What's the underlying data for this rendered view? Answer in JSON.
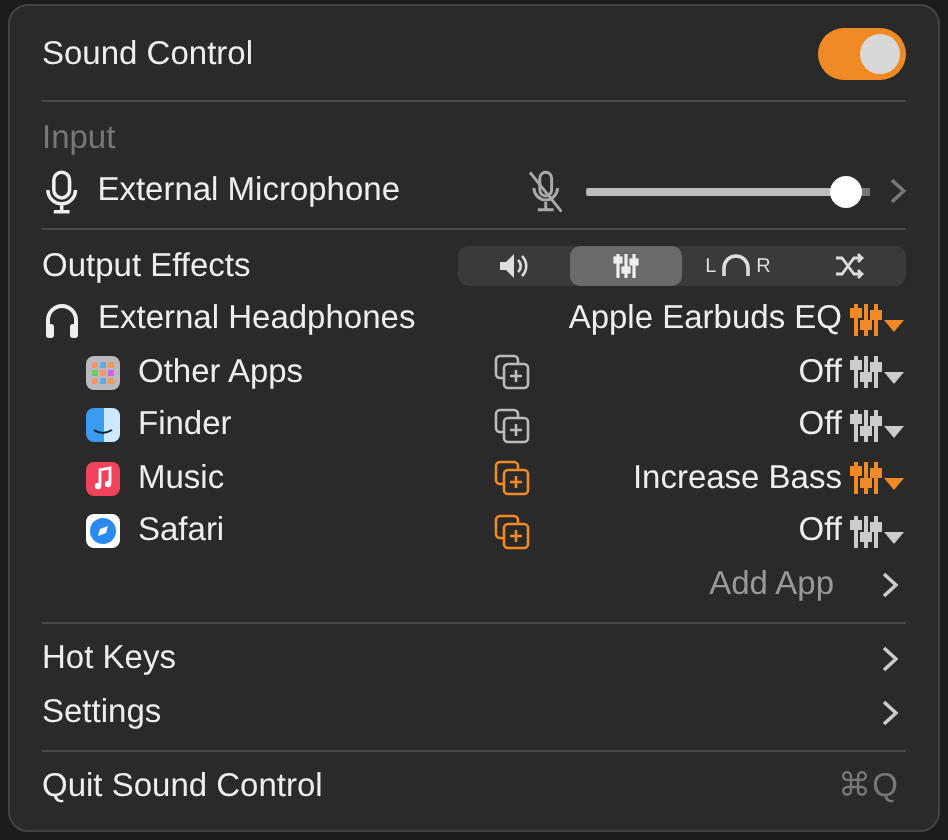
{
  "header": {
    "title": "Sound Control",
    "enabled": true
  },
  "input": {
    "heading": "Input",
    "device": "External Microphone",
    "muted": false,
    "level": 0.97
  },
  "output": {
    "heading": "Output Effects",
    "tabs": [
      {
        "kind": "volume",
        "selected": false
      },
      {
        "kind": "equalizer",
        "selected": true
      },
      {
        "kind": "balance",
        "left": "L",
        "right": "R",
        "selected": false
      },
      {
        "kind": "shuffle",
        "selected": false
      }
    ],
    "device": "External Headphones",
    "device_effect": "Apple Earbuds EQ",
    "device_eq_active": true,
    "apps": [
      {
        "kind": "grid",
        "name": "Other Apps",
        "copy_active": false,
        "effect": "Off",
        "eq_active": false
      },
      {
        "kind": "finder",
        "name": "Finder",
        "copy_active": false,
        "effect": "Off",
        "eq_active": false
      },
      {
        "kind": "music",
        "name": "Music",
        "copy_active": true,
        "effect": "Increase Bass",
        "eq_active": true
      },
      {
        "kind": "safari",
        "name": "Safari",
        "copy_active": true,
        "effect": "Off",
        "eq_active": false
      }
    ],
    "add_app": "Add App"
  },
  "menu": [
    {
      "label": "Hot Keys"
    },
    {
      "label": "Settings"
    }
  ],
  "quit": {
    "label": "Quit Sound Control",
    "shortcut": "⌘Q"
  }
}
